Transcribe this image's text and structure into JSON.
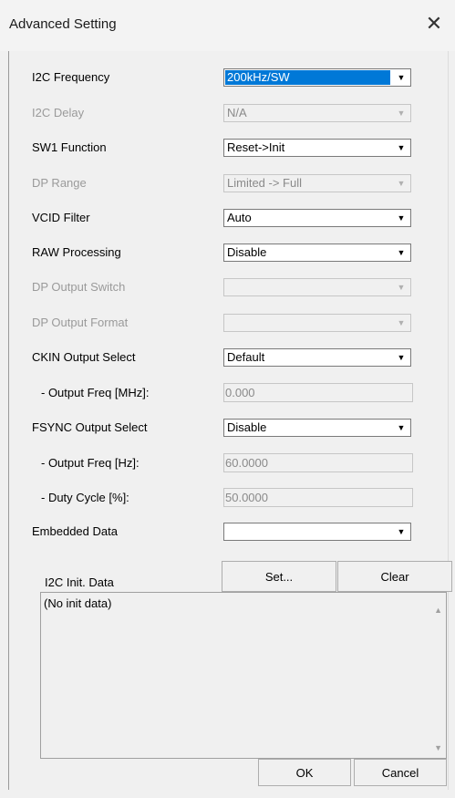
{
  "window": {
    "title": "Advanced Setting",
    "close_symbol": "✕"
  },
  "fields": {
    "i2c_frequency": {
      "label": "I2C Frequency",
      "value": "200kHz/SW"
    },
    "i2c_delay": {
      "label": "I2C Delay",
      "value": "N/A"
    },
    "sw1_function": {
      "label": "SW1 Function",
      "value": "Reset->Init"
    },
    "dp_range": {
      "label": "DP Range",
      "value": "Limited -> Full"
    },
    "vcid_filter": {
      "label": "VCID Filter",
      "value": "Auto"
    },
    "raw_processing": {
      "label": "RAW Processing",
      "value": "Disable"
    },
    "dp_output_switch": {
      "label": "DP Output Switch",
      "value": ""
    },
    "dp_output_format": {
      "label": "DP Output Format",
      "value": ""
    },
    "ckin_output_select": {
      "label": "CKIN Output Select",
      "value": "Default"
    },
    "ckin_output_freq": {
      "label": "- Output Freq [MHz]:",
      "value": "0.000"
    },
    "fsync_output_select": {
      "label": "FSYNC Output Select",
      "value": "Disable"
    },
    "fsync_output_freq": {
      "label": "- Output Freq [Hz]:",
      "value": "60.0000"
    },
    "fsync_duty_cycle": {
      "label": "- Duty Cycle [%]:",
      "value": "50.0000"
    },
    "embedded_data": {
      "label": "Embedded Data",
      "value": ""
    }
  },
  "i2c_init": {
    "label": "I2C Init. Data",
    "set_label": "Set...",
    "clear_label": "Clear",
    "content": "(No init data)"
  },
  "footer": {
    "ok_label": "OK",
    "cancel_label": "Cancel"
  },
  "colors": {
    "selection": "#0078d7",
    "disabled_text": "#9a9a9a",
    "background": "#f0f0f0"
  }
}
